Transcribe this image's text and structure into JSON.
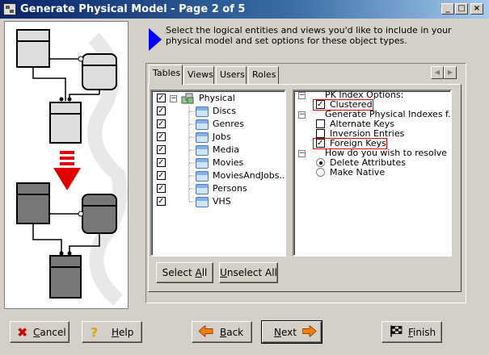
{
  "window": {
    "title": "Generate Physical Model - Page 2 of 5",
    "minimize": "_",
    "maximize": "□",
    "close": "×"
  },
  "instruction": "Select the logical entities and views you'd like to include in your physical model and set options for these object types.",
  "tabs": [
    {
      "label": "Tables",
      "active": true
    },
    {
      "label": "Views",
      "active": false
    },
    {
      "label": "Users",
      "active": false
    },
    {
      "label": "Roles",
      "active": false
    }
  ],
  "tree": {
    "root": {
      "label": "Physical",
      "checked": true,
      "expanded": true
    },
    "items": [
      {
        "label": "Discs",
        "checked": true
      },
      {
        "label": "Genres",
        "checked": true
      },
      {
        "label": "Jobs",
        "checked": true
      },
      {
        "label": "Media",
        "checked": true
      },
      {
        "label": "Movies",
        "checked": true
      },
      {
        "label": "MoviesAndJobs...",
        "checked": true
      },
      {
        "label": "Persons",
        "checked": true
      },
      {
        "label": "VHS",
        "checked": true
      }
    ]
  },
  "options": {
    "pk_group": "PK Index Options:",
    "clustered": {
      "label": "Clustered",
      "checked": true
    },
    "gen_group": "Generate Physical Indexes f...",
    "alternate_keys": {
      "label": "Alternate Keys",
      "checked": false
    },
    "inversion_entries": {
      "label": "Inversion Entries",
      "checked": false
    },
    "foreign_keys": {
      "label": "Foreign Keys",
      "checked": true
    },
    "resolve_group": "How do you wish to resolve ...",
    "delete_attributes": {
      "label": "Delete Attributes",
      "selected": true
    },
    "make_native": {
      "label": "Make Native",
      "selected": false
    }
  },
  "buttons": {
    "select_all": {
      "pre": "Select ",
      "u": "A",
      "post": "ll"
    },
    "unselect_all": {
      "pre": "",
      "u": "U",
      "post": "nselect All"
    },
    "cancel": {
      "pre": "",
      "u": "C",
      "post": "ancel"
    },
    "help": {
      "pre": "",
      "u": "H",
      "post": "elp"
    },
    "back": {
      "pre": "",
      "u": "B",
      "post": "ack"
    },
    "next": {
      "pre": "",
      "u": "N",
      "post": "ext"
    },
    "finish": {
      "pre": "",
      "u": "F",
      "post": "inish"
    }
  },
  "colors": {
    "title_start": "#0a246a",
    "title_end": "#a6caf0",
    "highlight_border": "#e00000",
    "pointer_blue": "#0000ff",
    "arrow_red": "#e00000",
    "back_next_arrow": "#f08010"
  }
}
